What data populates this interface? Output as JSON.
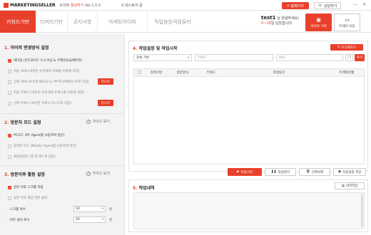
{
  "app": {
    "logo": "MARKETINGSELLER",
    "trial": "트레픽",
    "active": "활성하기",
    "version": "Ver.1.0.0",
    "store": "X 네스토어 글"
  },
  "top_buttons": {
    "home": "홈페이지",
    "consult": "상담하기"
  },
  "window_controls": {
    "minimize": "—",
    "close": "✕"
  },
  "tabs": [
    "키워드기반",
    "리퍼러기반",
    "공지사항",
    "마케팅아이피",
    "작업용원격컴퓨터"
  ],
  "user": {
    "id": "test1",
    "greeting": "님 안녕하세요!",
    "days": "0~16",
    "days_suffix": "일 남았습니다."
  },
  "big_buttons": {
    "purchase": "아이피 구매",
    "trial_use": "트레이 이동"
  },
  "sections": {
    "s1": {
      "num": "1.",
      "title": "아이피 변경방식 설정"
    },
    "s2": {
      "num": "2.",
      "title": "방문자 모드 설정",
      "guide": "가이드 보기"
    },
    "s3": {
      "num": "3.",
      "title": "방문이후 활동 설정",
      "guide": "가이드 보기"
    }
  },
  "ip_options": [
    {
      "label": "테더링 (안드로이드 5.0 이상 & 무제한요금제추천)",
      "checked": true
    },
    {
      "label": "자동 VPN (내장된 수천개의 VPN을 이용해 작업)",
      "checked": false
    },
    {
      "label": "선택 VPN (보유한 IKEV2 or PPTP VPN리스트로 작업)",
      "checked": false,
      "btn": "리스트"
    },
    {
      "label": "자동 프록시 (내장된 수천개의 프록시를 이용해 작업)",
      "checked": false
    },
    {
      "label": "선택 프록시 (보유한 프록시 리스트로 작업)",
      "checked": false,
      "btn": "리스트"
    }
  ],
  "visitor_options": [
    {
      "label": "PC모드 (PC Agent를 사용하여 방문)",
      "checked": true
    },
    {
      "label": "휴대폰 모드 (Mobile Agent를 사용하여 방문)",
      "checked": false
    },
    {
      "label": "태블릿방문 (탭 및 패드로 방문)",
      "checked": false
    }
  ],
  "after_options": [
    {
      "label": "방문 이후 스크롤 작업",
      "checked": true
    },
    {
      "label": "방문 이후 랜덤 버튼 클릭",
      "checked": false
    }
  ],
  "after_numbers": [
    {
      "label": "· 스크롤 횟수",
      "value": "10",
      "unit": "번"
    },
    {
      "label": "· 버튼 클릭 횟수",
      "value": "10",
      "unit": "번"
    }
  ],
  "panel4": {
    "num": "4.",
    "title": "작업설정 및 작업시작",
    "reset": "초기화하기",
    "search_mode": "검색 기반",
    "keyword_placeholder": "키워드",
    "url_placeholder": "URL",
    "add": "추가",
    "headers": [
      "검색기반",
      "방문방식",
      "키워드",
      "작업링크",
      "트래픽현황"
    ],
    "buttons": {
      "start": "작업시작",
      "stop": "작업정지",
      "delete": "선택삭제",
      "save": "작업설정 저장"
    }
  },
  "panel5": {
    "num": "5.",
    "title": "작업내역",
    "save_log": "내역저장"
  },
  "colors": {
    "accent": "#e8402b"
  }
}
